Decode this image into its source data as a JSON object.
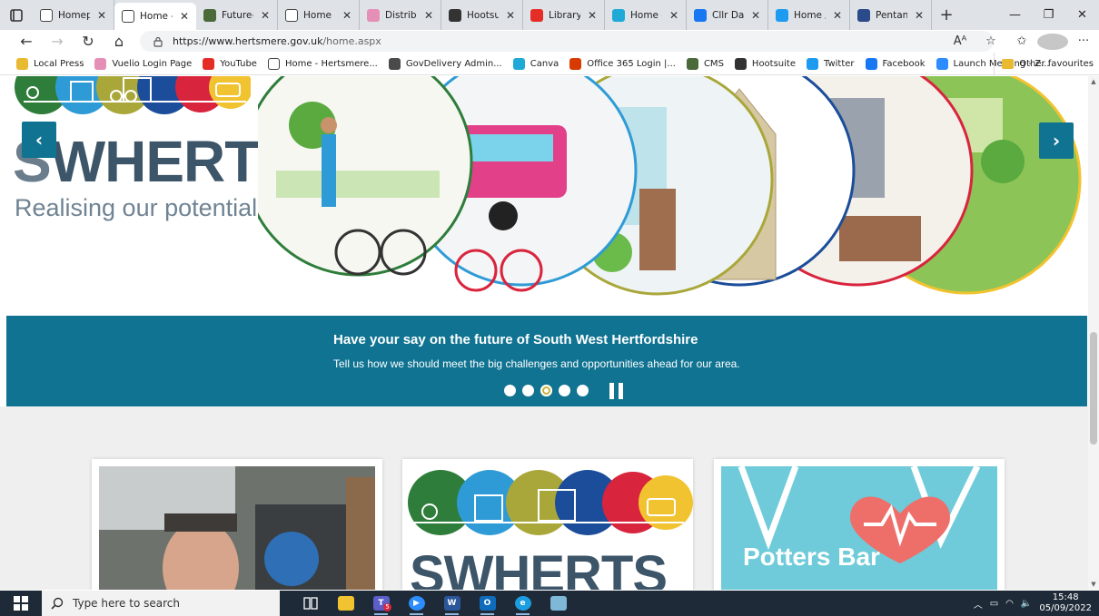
{
  "browser": {
    "tabs": [
      {
        "label": "Homepa",
        "icon": "page-icon",
        "active": false
      },
      {
        "label": "Home - H",
        "icon": "page-icon",
        "active": true
      },
      {
        "label": "Future-of",
        "icon": "site-icon",
        "active": false
      },
      {
        "label": "Home - H",
        "icon": "page-icon",
        "active": false
      },
      {
        "label": "Distributi",
        "icon": "flower-icon",
        "active": false
      },
      {
        "label": "Hootsuite",
        "icon": "hootsuite-icon",
        "active": false
      },
      {
        "label": "Library - ",
        "icon": "youtube-icon",
        "active": false
      },
      {
        "label": "Home - C",
        "icon": "canva-icon",
        "active": false
      },
      {
        "label": "Cllr Dan ",
        "icon": "facebook-icon",
        "active": false
      },
      {
        "label": "Home / T",
        "icon": "twitter-icon",
        "active": false
      },
      {
        "label": "Pentana ",
        "icon": "pentana-icon",
        "active": false
      }
    ],
    "url_host": "https://www.hertsmere.gov.uk",
    "url_path": "/home.aspx",
    "favourites": [
      {
        "label": "Local Press",
        "icon": "folder-icon",
        "color": "#e8b931"
      },
      {
        "label": "Vuelio Login Page",
        "icon": "vuelio-icon",
        "color": "#e58fb6"
      },
      {
        "label": "YouTube",
        "icon": "youtube-icon",
        "color": "#e52d27"
      },
      {
        "label": "Home - Hertsmere...",
        "icon": "page-icon",
        "color": "#ffffff"
      },
      {
        "label": "GovDelivery Admin...",
        "icon": "govdelivery-icon",
        "color": "#4a4a4a"
      },
      {
        "label": "Canva",
        "icon": "canva-icon",
        "color": "#1fa9d6"
      },
      {
        "label": "Office 365 Login |...",
        "icon": "office-icon",
        "color": "#d83b01"
      },
      {
        "label": "CMS",
        "icon": "cms-icon",
        "color": "#4a6a3a"
      },
      {
        "label": "Hootsuite",
        "icon": "hootsuite-icon",
        "color": "#333333"
      },
      {
        "label": "Twitter",
        "icon": "twitter-icon",
        "color": "#1d9bf0"
      },
      {
        "label": "Facebook",
        "icon": "facebook-icon",
        "color": "#1877f2"
      },
      {
        "label": "Launch Meeting - Z...",
        "icon": "zoom-icon",
        "color": "#2d8cff"
      }
    ],
    "other_favourites": "Other favourites"
  },
  "page": {
    "hero": {
      "logo_text_s": "S",
      "logo_text_rest": "WHERTS",
      "tagline": "Realising our potential"
    },
    "banner": {
      "title": "Have your say on the future of South West Hertfordshire",
      "text": "Tell us how we should meet the big challenges and opportunities ahead for our area.",
      "dot_count": 5,
      "active_dot": 3
    },
    "cards": [
      {
        "alt": "Councillor photo",
        "text": ""
      },
      {
        "alt": "SWHERTS logo",
        "text": "SWHERTS"
      },
      {
        "alt": "Potters Bar Health",
        "text": "Potters Bar"
      }
    ],
    "colors": {
      "accent": "#0f7391",
      "circle_green": "#2e7d3a",
      "circle_blue": "#2f9bd6",
      "circle_olive": "#a9a73a",
      "circle_navy": "#1b4d9a",
      "circle_red": "#d9243d",
      "circle_yellow": "#f2c330"
    }
  },
  "taskbar": {
    "search_placeholder": "Type here to search",
    "time": "15:48",
    "date": "05/09/2022",
    "teams_badge": "5"
  }
}
